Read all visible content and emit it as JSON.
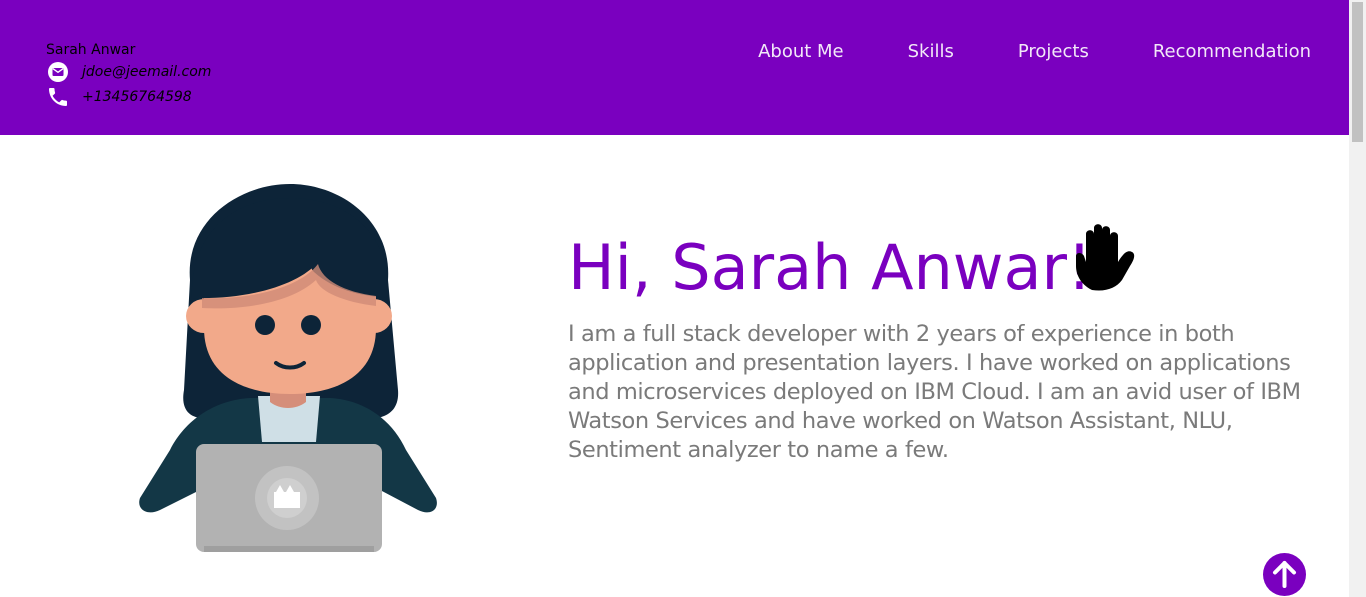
{
  "header": {
    "name": "Sarah Anwar",
    "email": "jdoe@jeemail.com",
    "phone": "+13456764598",
    "email_icon": "email-icon",
    "phone_icon": "phone-icon",
    "nav": [
      {
        "label": "About Me"
      },
      {
        "label": "Skills"
      },
      {
        "label": "Projects"
      },
      {
        "label": "Recommendation"
      }
    ]
  },
  "hero": {
    "title": "Hi, Sarah Anwar!",
    "title_emoji_icon": "waving-hand-icon",
    "bio": "I am a full stack developer with 2 years of experience in both application and presentation layers. I have worked on applications and microservices deployed on IBM Cloud. I am an avid user of IBM Watson Services and have worked on Watson Assistant, NLU, Sentiment analyzer to name a few.",
    "avatar_icon": "developer-avatar-illustration"
  },
  "back_to_top_icon": "arrow-up-icon",
  "colors": {
    "brand": "#7a00bf",
    "text_muted": "#7a7a7a",
    "nav_text": "#f2e8f8"
  }
}
